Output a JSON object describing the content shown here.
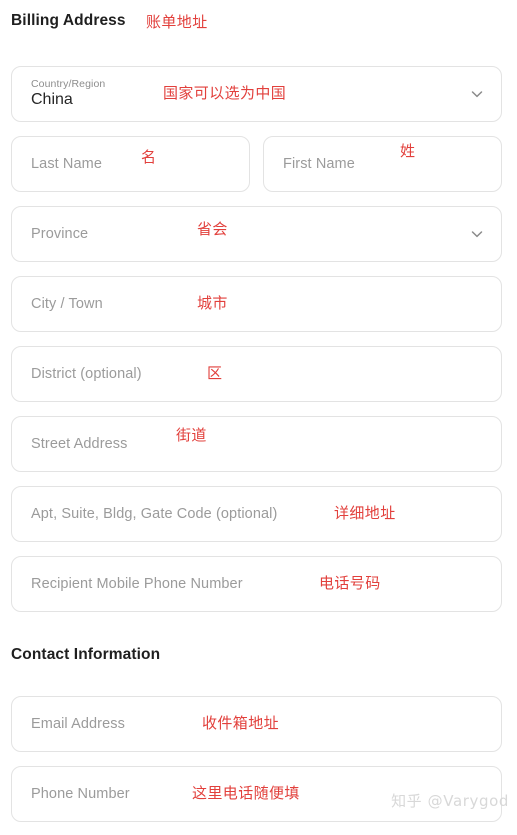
{
  "sections": [
    {
      "id": "billing",
      "title": "Billing Address",
      "annotation": "账单地址"
    },
    {
      "id": "contact",
      "title": "Contact Information",
      "annotation": ""
    }
  ],
  "billing": {
    "heading": "Billing Address",
    "heading_annotation": "账单地址",
    "country": {
      "label": "Country/Region",
      "value": "China",
      "annotation": "国家可以选为中国",
      "icon": "chevron-down-icon"
    },
    "last_name": {
      "placeholder": "Last Name",
      "value": "",
      "annotation": "名"
    },
    "first_name": {
      "placeholder": "First Name",
      "value": "",
      "annotation": "姓"
    },
    "province": {
      "placeholder": "Province",
      "value": "",
      "annotation": "省会",
      "icon": "chevron-down-icon"
    },
    "city": {
      "placeholder": "City / Town",
      "value": "",
      "annotation": "城市"
    },
    "district": {
      "placeholder": "District (optional)",
      "value": "",
      "annotation": "区"
    },
    "street": {
      "placeholder": "Street Address",
      "value": "",
      "annotation": "街道"
    },
    "apt": {
      "placeholder": "Apt, Suite, Bldg, Gate Code (optional)",
      "value": "",
      "annotation": "详细地址"
    },
    "recipient_phone": {
      "placeholder": "Recipient Mobile Phone Number",
      "value": "",
      "annotation": "电话号码"
    }
  },
  "contact": {
    "heading": "Contact Information",
    "email": {
      "placeholder": "Email Address",
      "value": "",
      "annotation": "收件箱地址"
    },
    "phone": {
      "placeholder": "Phone Number",
      "value": "",
      "annotation": "这里电话随便填"
    }
  },
  "watermark": {
    "text": "知乎 @Varygod"
  },
  "colors": {
    "annotation_red": "#e2403c",
    "placeholder_gray": "#9b9b9b",
    "heading_dark": "#1f1f1f",
    "field_border": "#e3e3e3",
    "page_background": "#ffffff",
    "watermark_gray": "#d8d8d8"
  }
}
